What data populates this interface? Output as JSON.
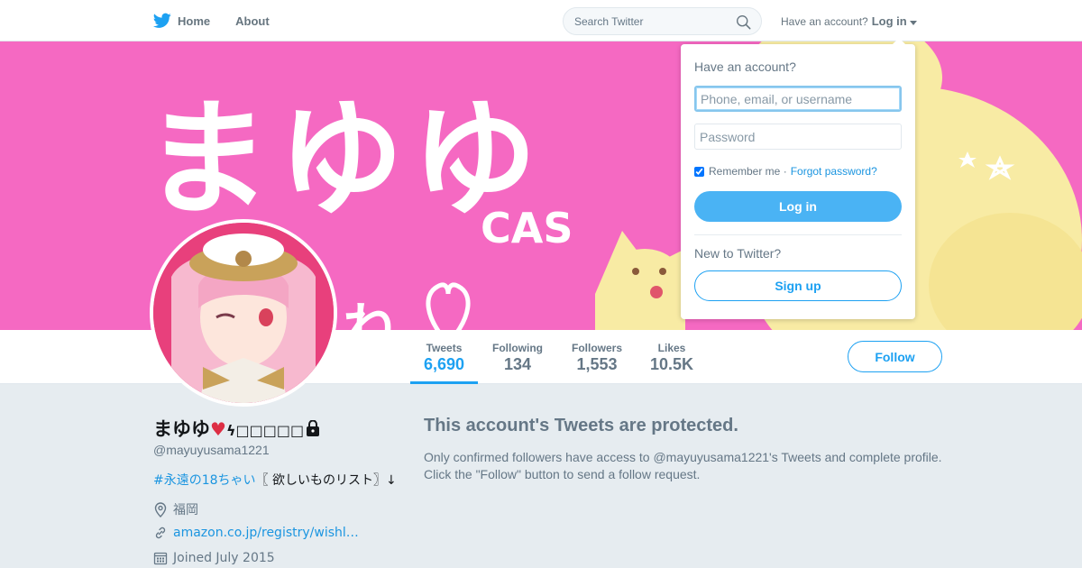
{
  "nav": {
    "home_label": "Home",
    "about_label": "About",
    "search_placeholder": "Search Twitter",
    "account_prompt": "Have an account?",
    "login_label": "Log in"
  },
  "banner": {
    "text_main": "まゆゆ",
    "text_cas": "CAS",
    "text_ne": "ね",
    "text_side": "✩．ₒ",
    "color": "#f569c2"
  },
  "stats": [
    {
      "label": "Tweets",
      "value": "6,690"
    },
    {
      "label": "Following",
      "value": "134"
    },
    {
      "label": "Followers",
      "value": "1,553"
    },
    {
      "label": "Likes",
      "value": "10.5K"
    }
  ],
  "follow_label": "Follow",
  "profile": {
    "name": "まゆゆ",
    "name_suffix": "ϟ□□□□□",
    "handle": "@mayuyusama1221",
    "bio_tag": "#永遠の18ちゃい",
    "bio_rest": "〖 欲しいものリスト〗↓",
    "location": "福岡",
    "link": "amazon.co.jp/registry/wishl…",
    "joined": "Joined July 2015"
  },
  "protected": {
    "title": "This account's Tweets are protected.",
    "text": "Only confirmed followers have access to @mayuyusama1221's Tweets and complete profile. Click the \"Follow\" button to send a follow request."
  },
  "login_dropdown": {
    "title": "Have an account?",
    "username_placeholder": "Phone, email, or username",
    "password_placeholder": "Password",
    "remember_label": "Remember me",
    "separator": "·",
    "forgot_label": "Forgot password?",
    "login_button": "Log in",
    "new_prompt": "New to Twitter?",
    "signup_button": "Sign up"
  },
  "colors": {
    "accent": "#1da1f2",
    "login_button": "#4ab3f4",
    "background": "#e6ecf0"
  }
}
